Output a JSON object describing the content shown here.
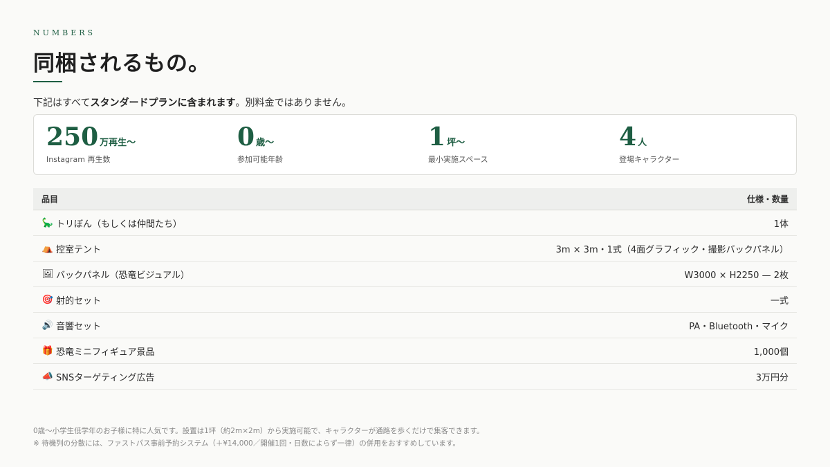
{
  "header": {
    "eyebrow": "NUMBERS",
    "title": "同梱されるもの。",
    "lead_prefix": "下記はすべて",
    "lead_bold": "スタンダードプランに含まれます",
    "lead_suffix": "。別料金ではありません。"
  },
  "stats": [
    {
      "value": "250",
      "unit": "万再生〜",
      "label": "Instagram 再生数"
    },
    {
      "value": "0",
      "unit": "歳〜",
      "label": "参加可能年齢"
    },
    {
      "value": "1",
      "unit": "坪〜",
      "label": "最小実施スペース"
    },
    {
      "value": "4",
      "unit": "人",
      "label": "登場キャラクター"
    }
  ],
  "table": {
    "header_item": "品目",
    "header_spec": "仕様・数量",
    "rows": [
      {
        "icon": "dinosaur-icon",
        "glyph": "🦕",
        "item": "トリぼん（もしくは仲間たち）",
        "spec": "1体"
      },
      {
        "icon": "tent-icon",
        "glyph": "⛺",
        "item": "控室テント",
        "spec": "3m × 3m・1式（4面グラフィック・撮影バックパネル）"
      },
      {
        "icon": "picture-icon",
        "glyph": "🖼",
        "item": "バックパネル（恐竜ビジュアル）",
        "spec": "W3000 × H2250 — 2枚"
      },
      {
        "icon": "target-icon",
        "glyph": "🎯",
        "item": "射的セット",
        "spec": "一式"
      },
      {
        "icon": "speaker-icon",
        "glyph": "🔊",
        "item": "音響セット",
        "spec": "PA・Bluetooth・マイク"
      },
      {
        "icon": "gift-icon",
        "glyph": "🎁",
        "item": "恐竜ミニフィギュア景品",
        "spec": "1,000個"
      },
      {
        "icon": "megaphone-icon",
        "glyph": "📣",
        "item": "SNSターゲティング広告",
        "spec": "3万円分"
      }
    ]
  },
  "footnotes": [
    "0歳〜小学生低学年のお子様に特に人気です。設置は1坪（約2m×2m）から実施可能で、キャラクターが通路を歩くだけで集客できます。",
    "※ 待機列の分散には、ファストパス事前予約システム（＋¥14,000／開催1回・日数によらず一律）の併用をおすすめしています。"
  ]
}
